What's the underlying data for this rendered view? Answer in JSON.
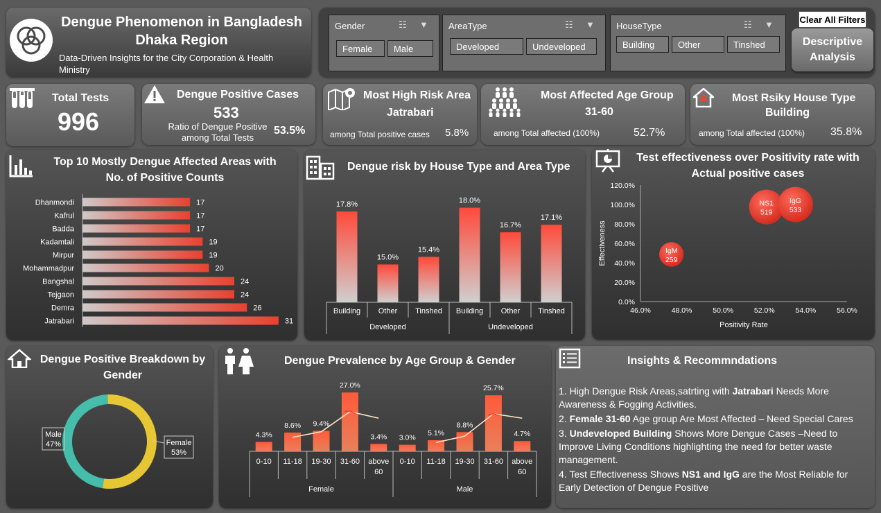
{
  "header": {
    "title_line1": "Dengue Phenomenon in Bangladesh",
    "title_line2": "Dhaka Region",
    "subtitle_line1": "Data-Driven Insights for the City Corporation & Health",
    "subtitle_line2": "Ministry"
  },
  "filters": {
    "gender": {
      "title": "Gender",
      "options": [
        "Female",
        "Male"
      ]
    },
    "area_type": {
      "title": "AreaType",
      "options": [
        "Developed",
        "Undeveloped"
      ]
    },
    "house_type": {
      "title": "HouseType",
      "options": [
        "Building",
        "Other",
        "Tinshed"
      ]
    },
    "clear_label": "Clear All Filters",
    "analysis_line1": "Descriptive",
    "analysis_line2": "Analysis"
  },
  "kpis": {
    "total_tests": {
      "label": "Total Tests",
      "value": "996"
    },
    "positive": {
      "label": "Dengue Positive Cases",
      "value": "533",
      "sub1": "Ratio of Dengue Positive",
      "sub2": "among Total Tests",
      "pct": "53.5%"
    },
    "risk_area": {
      "label": "Most High Risk Area",
      "value": "Jatrabari",
      "sub": "among Total positive cases",
      "pct": "5.8%"
    },
    "age_group": {
      "label": "Most Affected Age Group",
      "value": "31-60",
      "sub": "among Total affected (100%)",
      "pct": "52.7%"
    },
    "house_type": {
      "label_line1": "Most Rsiky House Type",
      "value": "Building",
      "sub": "among Total affected (100%)",
      "pct": "35.8%"
    }
  },
  "areas_panel": {
    "title_line1": "Top 10 Mostly Dengue Affected Areas with",
    "title_line2": "No. of Positive Counts"
  },
  "house_panel": {
    "title": "Dengue risk by House Type and Area Type"
  },
  "effect_panel": {
    "title_line1": "Test effectiveness over Positivity rate with",
    "title_line2": "Actual positive cases"
  },
  "gender_panel": {
    "title_line1": "Dengue Positive Breakdown by",
    "title_line2": "Gender"
  },
  "age_panel": {
    "title": "Dengue Prevalence by Age Group & Gender"
  },
  "insights": {
    "title": "Insights & Recommndations",
    "items": [
      {
        "pre": "1. High Dengue Risk Areas,satrting with ",
        "bold": "Jatrabari",
        "post": " Needs More Awareness & Fogging Activities."
      },
      {
        "pre": "2. ",
        "bold": "Female 31-60",
        "post": " Age group Are Most Affected – Need Special Cares"
      },
      {
        "pre": "3. ",
        "bold": "Undeveloped Building",
        "post": " Shows More Dengue  Cases –Need to Improve Living Conditions highlighting the need for better waste management."
      },
      {
        "pre": "4. Test Effectiveness Shows ",
        "bold": "NS1 and IgG",
        "post": " are the Most Reliable for Early Detection of Dengue Positive"
      }
    ]
  },
  "chart_data": [
    {
      "type": "bar",
      "orientation": "horizontal",
      "categories": [
        "Dhanmondi",
        "Kafrul",
        "Badda",
        "Kadamtali",
        "Mirpur",
        "Mohammadpur",
        "Bangshal",
        "Tejgaon",
        "Demra",
        "Jatrabari"
      ],
      "values": [
        17,
        17,
        17,
        19,
        19,
        20,
        24,
        24,
        26,
        31
      ],
      "xlim": [
        0,
        32
      ]
    },
    {
      "type": "bar",
      "groups": [
        "Developed",
        "Undeveloped"
      ],
      "categories": [
        "Building",
        "Other",
        "Tinshed"
      ],
      "values": [
        [
          17.8,
          15.0,
          15.4
        ],
        [
          18.0,
          16.7,
          17.1
        ]
      ],
      "labels": [
        [
          "17.8%",
          "15.0%",
          "15.4%"
        ],
        [
          "18.0%",
          "16.7%",
          "17.1%"
        ]
      ],
      "ylim": [
        13,
        18.5
      ]
    },
    {
      "type": "scatter",
      "xlabel": "Positivity Rate",
      "ylabel": "Effectiveness",
      "xticks": [
        "46.0%",
        "48.0%",
        "50.0%",
        "52.0%",
        "54.0%",
        "56.0%"
      ],
      "yticks": [
        "0.0%",
        "20.0%",
        "40.0%",
        "60.0%",
        "80.0%",
        "100.0%",
        "120.0%"
      ],
      "xlim": [
        46,
        56
      ],
      "ylim": [
        0,
        120
      ],
      "points": [
        {
          "name": "NS1",
          "x": 52.1,
          "y": 97.4,
          "size": 519
        },
        {
          "name": "IgG",
          "x": 53.5,
          "y": 100,
          "size": 533
        },
        {
          "name": "IgM",
          "x": 47.5,
          "y": 48.6,
          "size": 259
        }
      ]
    },
    {
      "type": "pie",
      "slices": [
        {
          "label": "Female",
          "value": 53,
          "text": "53%",
          "color": "#f5d232"
        },
        {
          "label": "Male",
          "value": 47,
          "text": "47%",
          "color": "#48c8b4"
        }
      ]
    },
    {
      "type": "bar",
      "groups": [
        "Female",
        "Male"
      ],
      "categories": [
        "0-10",
        "11-18",
        "19-30",
        "31-60",
        "above 60"
      ],
      "values": [
        [
          4.3,
          8.6,
          9.4,
          27.0,
          3.4
        ],
        [
          3.0,
          5.1,
          8.8,
          25.7,
          4.7
        ]
      ],
      "labels": [
        [
          "4.3%",
          "8.6%",
          "9.4%",
          "27.0%",
          "3.4%"
        ],
        [
          "3.0%",
          "5.1%",
          "8.8%",
          "25.7%",
          "4.7%"
        ]
      ],
      "ylim": [
        0,
        28
      ]
    }
  ]
}
